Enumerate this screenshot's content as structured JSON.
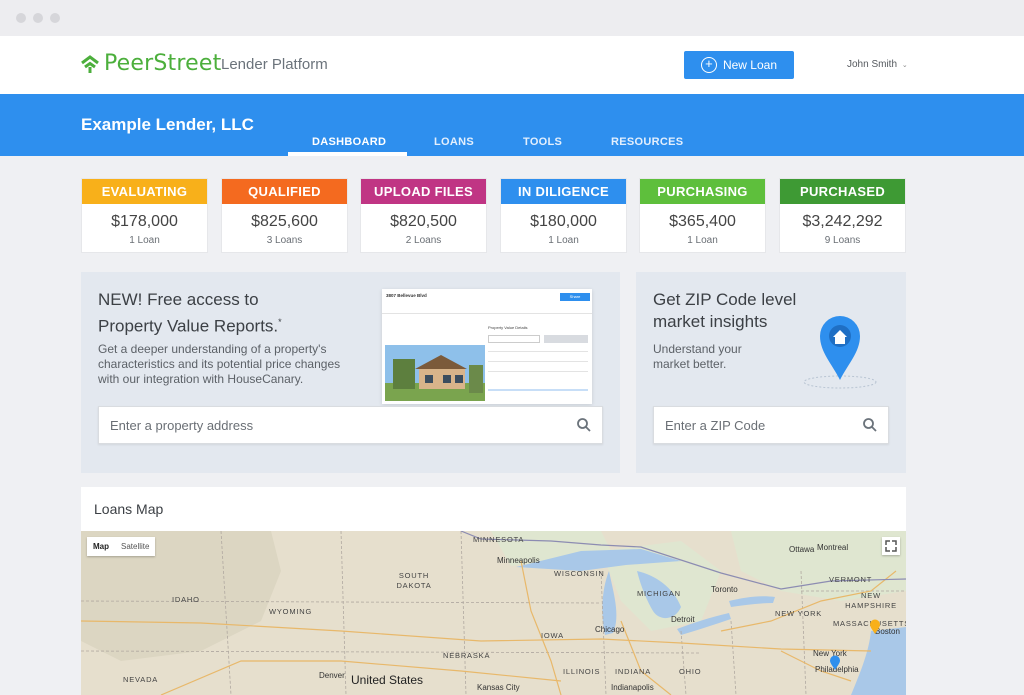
{
  "header": {
    "brand": "PeerStreet",
    "platform": "Lender Platform",
    "new_loan_label": "New Loan",
    "user_name": "John Smith",
    "brand_color": "#4caf3c",
    "accent_color": "#2e8fee"
  },
  "hero": {
    "lender_name": "Example Lender, LLC",
    "tabs": [
      {
        "label": "DASHBOARD",
        "active": true
      },
      {
        "label": "LOANS",
        "active": false
      },
      {
        "label": "TOOLS",
        "active": false
      },
      {
        "label": "RESOURCES",
        "active": false
      }
    ]
  },
  "pipeline": [
    {
      "status": "EVALUATING",
      "amount": "$178,000",
      "count": "1 Loan",
      "color": "#f8b01a"
    },
    {
      "status": "QUALIFIED",
      "amount": "$825,600",
      "count": "3 Loans",
      "color": "#f46a1f"
    },
    {
      "status": "UPLOAD FILES",
      "amount": "$820,500",
      "count": "2 Loans",
      "color": "#c03584"
    },
    {
      "status": "IN DILIGENCE",
      "amount": "$180,000",
      "count": "1 Loan",
      "color": "#2e8fee"
    },
    {
      "status": "PURCHASING",
      "amount": "$365,400",
      "count": "1 Loan",
      "color": "#5ebf3c"
    },
    {
      "status": "PURCHASED",
      "amount": "$3,242,292",
      "count": "9 Loans",
      "color": "#3e9a34"
    }
  ],
  "promo": {
    "heading_line1": "NEW! Free access to",
    "heading_line2": "Property Value Reports.",
    "heading_mark": "*",
    "body_line1": "Get a deeper understanding of a property's",
    "body_line2": "characteristics and its potential price changes",
    "body_line3": "with our integration with HouseCanary.",
    "search_placeholder": "Enter a property address",
    "preview_address": "3807 Bellevue Blvd",
    "preview_button": "Share",
    "preview_label": "Property Value Details"
  },
  "zip": {
    "heading_line1": "Get ZIP Code level",
    "heading_line2": "market insights",
    "body_line1": "Understand your",
    "body_line2": "market better.",
    "search_placeholder": "Enter a ZIP Code"
  },
  "map": {
    "title": "Loans Map",
    "toggle_map": "Map",
    "toggle_satellite": "Satellite",
    "country": "United States",
    "states": [
      "MINNESOTA",
      "SOUTH DAKOTA",
      "WISCONSIN",
      "MICHIGAN",
      "IDAHO",
      "WYOMING",
      "IOWA",
      "ILLINOIS",
      "INDIANA",
      "OHIO",
      "NEBRASKA",
      "NEVADA",
      "VERMONT",
      "NEW HAMPSHIRE",
      "NEW YORK",
      "MASSACHUSETTS"
    ],
    "cities": [
      "Minneapolis",
      "Ottawa",
      "Montreal",
      "Toronto",
      "Detroit",
      "Chicago",
      "Denver",
      "Kansas City",
      "Indianapolis",
      "Philadelphia",
      "New York",
      "Boston"
    ]
  }
}
